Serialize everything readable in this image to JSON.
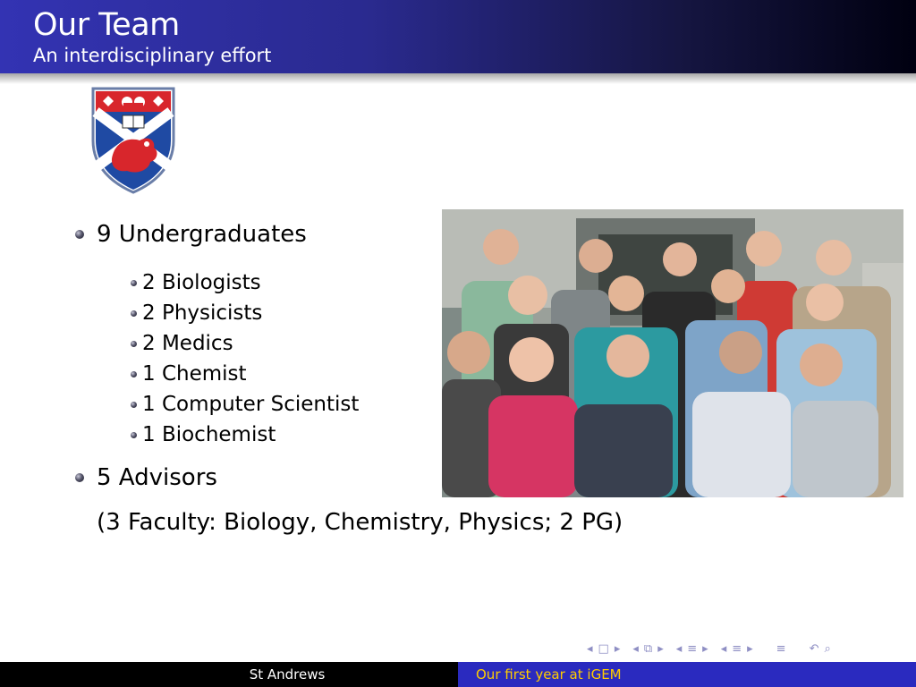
{
  "header": {
    "title": "Our Team",
    "subtitle": "An interdisciplinary effort"
  },
  "bullets": {
    "undergrads": "9 Undergraduates",
    "sub": [
      "2 Biologists",
      "2 Physicists",
      "2 Medics",
      "1 Chemist",
      "1 Computer Scientist",
      "1 Biochemist"
    ],
    "advisors": "5 Advisors",
    "advisors_note": "(3 Faculty: Biology, Chemistry, Physics; 2 PG)"
  },
  "navigation": {
    "icons": [
      "nav-frame-left-icon",
      "nav-frame-icon",
      "nav-frame-right-icon",
      "nav-subsection-left-icon",
      "nav-subsection-icon",
      "nav-subsection-right-icon",
      "nav-section-left-icon",
      "nav-section-icon",
      "nav-section-right-icon",
      "nav-align-icon",
      "nav-undo-icon",
      "nav-search-icon"
    ]
  },
  "footer": {
    "author": "St Andrews",
    "talk_title": "Our first year at iGEM"
  },
  "colors": {
    "header_start": "#3333b3",
    "header_end": "#000010",
    "footer_left": "#000000",
    "footer_right": "#2a2abf",
    "footer_right_text": "#ffcc00"
  }
}
